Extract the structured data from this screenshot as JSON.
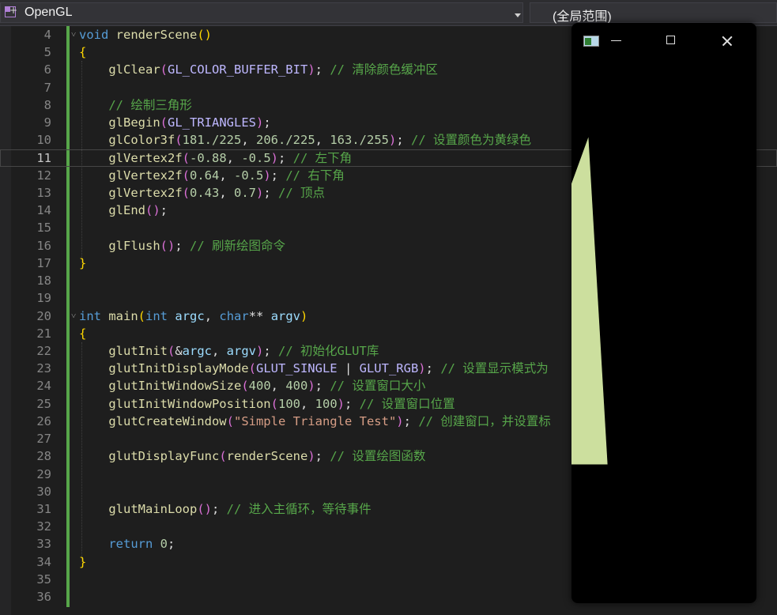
{
  "navigation_bar": {
    "project": "OpenGL",
    "scope": "(全局范围)"
  },
  "code_lines": [
    {
      "n": "4",
      "current": false,
      "fold": true,
      "tokens": [
        {
          "t": "kw",
          "v": "void"
        },
        {
          "t": "",
          "v": " "
        },
        {
          "t": "fn",
          "v": "renderScene"
        },
        {
          "t": "br1",
          "v": "()"
        }
      ]
    },
    {
      "n": "5",
      "current": false,
      "fold": false,
      "tokens": [
        {
          "t": "br1",
          "v": "{"
        }
      ]
    },
    {
      "n": "6",
      "current": false,
      "fold": false,
      "tokens": [
        {
          "t": "",
          "v": "    "
        },
        {
          "t": "fn",
          "v": "glClear"
        },
        {
          "t": "br2",
          "v": "("
        },
        {
          "t": "mac",
          "v": "GL_COLOR_BUFFER_BIT"
        },
        {
          "t": "br2",
          "v": ")"
        },
        {
          "t": "",
          "v": "; "
        },
        {
          "t": "cmt",
          "v": "// 清除颜色缓冲区"
        }
      ]
    },
    {
      "n": "7",
      "current": false,
      "fold": false,
      "tokens": []
    },
    {
      "n": "8",
      "current": false,
      "fold": false,
      "tokens": [
        {
          "t": "",
          "v": "    "
        },
        {
          "t": "cmt",
          "v": "// 绘制三角形"
        }
      ]
    },
    {
      "n": "9",
      "current": false,
      "fold": false,
      "tokens": [
        {
          "t": "",
          "v": "    "
        },
        {
          "t": "fn",
          "v": "glBegin"
        },
        {
          "t": "br2",
          "v": "("
        },
        {
          "t": "mac",
          "v": "GL_TRIANGLES"
        },
        {
          "t": "br2",
          "v": ")"
        },
        {
          "t": "",
          "v": ";"
        }
      ]
    },
    {
      "n": "10",
      "current": false,
      "fold": false,
      "tokens": [
        {
          "t": "",
          "v": "    "
        },
        {
          "t": "fn",
          "v": "glColor3f"
        },
        {
          "t": "br2",
          "v": "("
        },
        {
          "t": "num",
          "v": "181./225"
        },
        {
          "t": "",
          "v": ", "
        },
        {
          "t": "num",
          "v": "206./225"
        },
        {
          "t": "",
          "v": ", "
        },
        {
          "t": "num",
          "v": "163./255"
        },
        {
          "t": "br2",
          "v": ")"
        },
        {
          "t": "",
          "v": "; "
        },
        {
          "t": "cmt",
          "v": "// 设置颜色为黄绿色"
        }
      ]
    },
    {
      "n": "11",
      "current": true,
      "fold": false,
      "tokens": [
        {
          "t": "",
          "v": "    "
        },
        {
          "t": "fn",
          "v": "glVertex2f"
        },
        {
          "t": "br2",
          "v": "("
        },
        {
          "t": "num",
          "v": "-0.88"
        },
        {
          "t": "",
          "v": ", "
        },
        {
          "t": "num",
          "v": "-0.5"
        },
        {
          "t": "br2",
          "v": ")"
        },
        {
          "t": "",
          "v": "; "
        },
        {
          "t": "cmt",
          "v": "// 左下角"
        }
      ]
    },
    {
      "n": "12",
      "current": false,
      "fold": false,
      "tokens": [
        {
          "t": "",
          "v": "    "
        },
        {
          "t": "fn",
          "v": "glVertex2f"
        },
        {
          "t": "br2",
          "v": "("
        },
        {
          "t": "num",
          "v": "0.64"
        },
        {
          "t": "",
          "v": ", "
        },
        {
          "t": "num",
          "v": "-0.5"
        },
        {
          "t": "br2",
          "v": ")"
        },
        {
          "t": "",
          "v": "; "
        },
        {
          "t": "cmt",
          "v": "// 右下角"
        }
      ]
    },
    {
      "n": "13",
      "current": false,
      "fold": false,
      "tokens": [
        {
          "t": "",
          "v": "    "
        },
        {
          "t": "fn",
          "v": "glVertex2f"
        },
        {
          "t": "br2",
          "v": "("
        },
        {
          "t": "num",
          "v": "0.43"
        },
        {
          "t": "",
          "v": ", "
        },
        {
          "t": "num",
          "v": "0.7"
        },
        {
          "t": "br2",
          "v": ")"
        },
        {
          "t": "",
          "v": "; "
        },
        {
          "t": "cmt",
          "v": "// 顶点"
        }
      ]
    },
    {
      "n": "14",
      "current": false,
      "fold": false,
      "tokens": [
        {
          "t": "",
          "v": "    "
        },
        {
          "t": "fn",
          "v": "glEnd"
        },
        {
          "t": "br2",
          "v": "()"
        },
        {
          "t": "",
          "v": ";"
        }
      ]
    },
    {
      "n": "15",
      "current": false,
      "fold": false,
      "tokens": []
    },
    {
      "n": "16",
      "current": false,
      "fold": false,
      "tokens": [
        {
          "t": "",
          "v": "    "
        },
        {
          "t": "fn",
          "v": "glFlush"
        },
        {
          "t": "br2",
          "v": "()"
        },
        {
          "t": "",
          "v": "; "
        },
        {
          "t": "cmt",
          "v": "// 刷新绘图命令"
        }
      ]
    },
    {
      "n": "17",
      "current": false,
      "fold": false,
      "tokens": [
        {
          "t": "br1",
          "v": "}"
        }
      ]
    },
    {
      "n": "18",
      "current": false,
      "fold": false,
      "tokens": []
    },
    {
      "n": "19",
      "current": false,
      "fold": false,
      "tokens": []
    },
    {
      "n": "20",
      "current": false,
      "fold": true,
      "tokens": [
        {
          "t": "kw",
          "v": "int"
        },
        {
          "t": "",
          "v": " "
        },
        {
          "t": "fn",
          "v": "main"
        },
        {
          "t": "br1",
          "v": "("
        },
        {
          "t": "kw",
          "v": "int"
        },
        {
          "t": "",
          "v": " "
        },
        {
          "t": "par",
          "v": "argc"
        },
        {
          "t": "",
          "v": ", "
        },
        {
          "t": "kw",
          "v": "char"
        },
        {
          "t": "",
          "v": "** "
        },
        {
          "t": "par",
          "v": "argv"
        },
        {
          "t": "br1",
          "v": ")"
        }
      ]
    },
    {
      "n": "21",
      "current": false,
      "fold": false,
      "tokens": [
        {
          "t": "br1",
          "v": "{"
        }
      ]
    },
    {
      "n": "22",
      "current": false,
      "fold": false,
      "tokens": [
        {
          "t": "",
          "v": "    "
        },
        {
          "t": "fn",
          "v": "glutInit"
        },
        {
          "t": "br2",
          "v": "("
        },
        {
          "t": "",
          "v": "&"
        },
        {
          "t": "par",
          "v": "argc"
        },
        {
          "t": "",
          "v": ", "
        },
        {
          "t": "par",
          "v": "argv"
        },
        {
          "t": "br2",
          "v": ")"
        },
        {
          "t": "",
          "v": "; "
        },
        {
          "t": "cmt",
          "v": "// 初始化GLUT库"
        }
      ]
    },
    {
      "n": "23",
      "current": false,
      "fold": false,
      "tokens": [
        {
          "t": "",
          "v": "    "
        },
        {
          "t": "fn",
          "v": "glutInitDisplayMode"
        },
        {
          "t": "br2",
          "v": "("
        },
        {
          "t": "mac",
          "v": "GLUT_SINGLE"
        },
        {
          "t": "",
          "v": " | "
        },
        {
          "t": "mac",
          "v": "GLUT_RGB"
        },
        {
          "t": "br2",
          "v": ")"
        },
        {
          "t": "",
          "v": "; "
        },
        {
          "t": "cmt",
          "v": "// 设置显示模式为"
        }
      ]
    },
    {
      "n": "24",
      "current": false,
      "fold": false,
      "tokens": [
        {
          "t": "",
          "v": "    "
        },
        {
          "t": "fn",
          "v": "glutInitWindowSize"
        },
        {
          "t": "br2",
          "v": "("
        },
        {
          "t": "num",
          "v": "400"
        },
        {
          "t": "",
          "v": ", "
        },
        {
          "t": "num",
          "v": "400"
        },
        {
          "t": "br2",
          "v": ")"
        },
        {
          "t": "",
          "v": "; "
        },
        {
          "t": "cmt",
          "v": "// 设置窗口大小"
        }
      ]
    },
    {
      "n": "25",
      "current": false,
      "fold": false,
      "tokens": [
        {
          "t": "",
          "v": "    "
        },
        {
          "t": "fn",
          "v": "glutInitWindowPosition"
        },
        {
          "t": "br2",
          "v": "("
        },
        {
          "t": "num",
          "v": "100"
        },
        {
          "t": "",
          "v": ", "
        },
        {
          "t": "num",
          "v": "100"
        },
        {
          "t": "br2",
          "v": ")"
        },
        {
          "t": "",
          "v": "; "
        },
        {
          "t": "cmt",
          "v": "// 设置窗口位置"
        }
      ]
    },
    {
      "n": "26",
      "current": false,
      "fold": false,
      "tokens": [
        {
          "t": "",
          "v": "    "
        },
        {
          "t": "fn",
          "v": "glutCreateWindow"
        },
        {
          "t": "br2",
          "v": "("
        },
        {
          "t": "str",
          "v": "\"Simple Triangle Test\""
        },
        {
          "t": "br2",
          "v": ")"
        },
        {
          "t": "",
          "v": "; "
        },
        {
          "t": "cmt",
          "v": "// 创建窗口，并设置标"
        }
      ]
    },
    {
      "n": "27",
      "current": false,
      "fold": false,
      "tokens": []
    },
    {
      "n": "28",
      "current": false,
      "fold": false,
      "tokens": [
        {
          "t": "",
          "v": "    "
        },
        {
          "t": "fn",
          "v": "glutDisplayFunc"
        },
        {
          "t": "br2",
          "v": "("
        },
        {
          "t": "fn",
          "v": "renderScene"
        },
        {
          "t": "br2",
          "v": ")"
        },
        {
          "t": "",
          "v": "; "
        },
        {
          "t": "cmt",
          "v": "// 设置绘图函数"
        }
      ]
    },
    {
      "n": "29",
      "current": false,
      "fold": false,
      "tokens": []
    },
    {
      "n": "30",
      "current": false,
      "fold": false,
      "tokens": []
    },
    {
      "n": "31",
      "current": false,
      "fold": false,
      "tokens": [
        {
          "t": "",
          "v": "    "
        },
        {
          "t": "fn",
          "v": "glutMainLoop"
        },
        {
          "t": "br2",
          "v": "()"
        },
        {
          "t": "",
          "v": "; "
        },
        {
          "t": "cmt",
          "v": "// 进入主循环，等待事件"
        }
      ]
    },
    {
      "n": "32",
      "current": false,
      "fold": false,
      "tokens": []
    },
    {
      "n": "33",
      "current": false,
      "fold": false,
      "tokens": [
        {
          "t": "",
          "v": "    "
        },
        {
          "t": "kw",
          "v": "return"
        },
        {
          "t": "",
          "v": " "
        },
        {
          "t": "num",
          "v": "0"
        },
        {
          "t": "",
          "v": ";"
        }
      ]
    },
    {
      "n": "34",
      "current": false,
      "fold": false,
      "tokens": [
        {
          "t": "br1",
          "v": "}"
        }
      ]
    },
    {
      "n": "35",
      "current": false,
      "fold": false,
      "tokens": []
    },
    {
      "n": "36",
      "current": false,
      "fold": false,
      "tokens": []
    }
  ],
  "gl_window": {
    "background_color": "#000000",
    "triangle": {
      "color": "#ccdf9e",
      "vertices": [
        [
          -0.88,
          -0.5
        ],
        [
          0.64,
          -0.5
        ],
        [
          0.43,
          0.7
        ]
      ]
    }
  },
  "colors": {
    "editor_background": "#1e1e1e",
    "change_bar": "#57a64a"
  }
}
